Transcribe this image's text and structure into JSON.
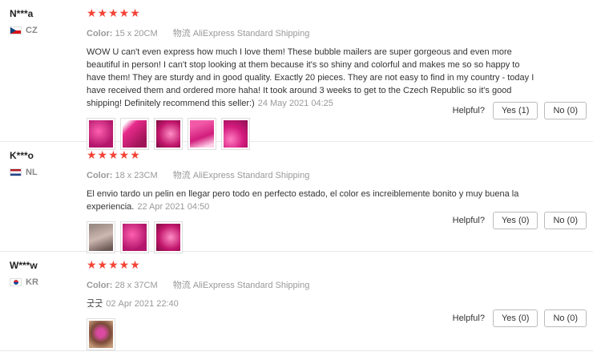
{
  "reviews": [
    {
      "user": "N***a",
      "country": "CZ",
      "stars": "★★★★★",
      "color_label": "Color:",
      "color_value": "15 x 20CM",
      "shipping_label": "物流",
      "shipping_value": "AliExpress Standard Shipping",
      "text": "WOW U can't even express how much I love them! These bubble mailers are super gorgeous and even more beautiful in person! I can't stop looking at them because it's so shiny and colorful and makes me so so happy to have them! They are sturdy and in good quality. Exactly 20 pieces. They are not easy to find in my country - today I have received them and ordered more haha! It took around 3 weeks to get to the Czech Republic so it's good shipping! Definitely recommend this seller:)",
      "date": "24 May 2021 04:25",
      "helpful_label": "Helpful?",
      "yes": "Yes (1)",
      "no": "No (0)"
    },
    {
      "user": "K***o",
      "country": "NL",
      "stars": "★★★★★",
      "color_label": "Color:",
      "color_value": "18 x 23CM",
      "shipping_label": "物流",
      "shipping_value": "AliExpress Standard Shipping",
      "text": "El envio tardo un pelin en llegar pero todo en perfecto estado, el color es increiblemente bonito y muy buena la experiencia.",
      "date": "22 Apr 2021 04:50",
      "helpful_label": "Helpful?",
      "yes": "Yes (0)",
      "no": "No (0)"
    },
    {
      "user": "W***w",
      "country": "KR",
      "stars": "★★★★★",
      "color_label": "Color:",
      "color_value": "28 x 37CM",
      "shipping_label": "物流",
      "shipping_value": "AliExpress Standard Shipping",
      "text": "굿굿",
      "date": "02 Apr 2021 22:40",
      "helpful_label": "Helpful?",
      "yes": "Yes (0)",
      "no": "No (0)"
    }
  ]
}
